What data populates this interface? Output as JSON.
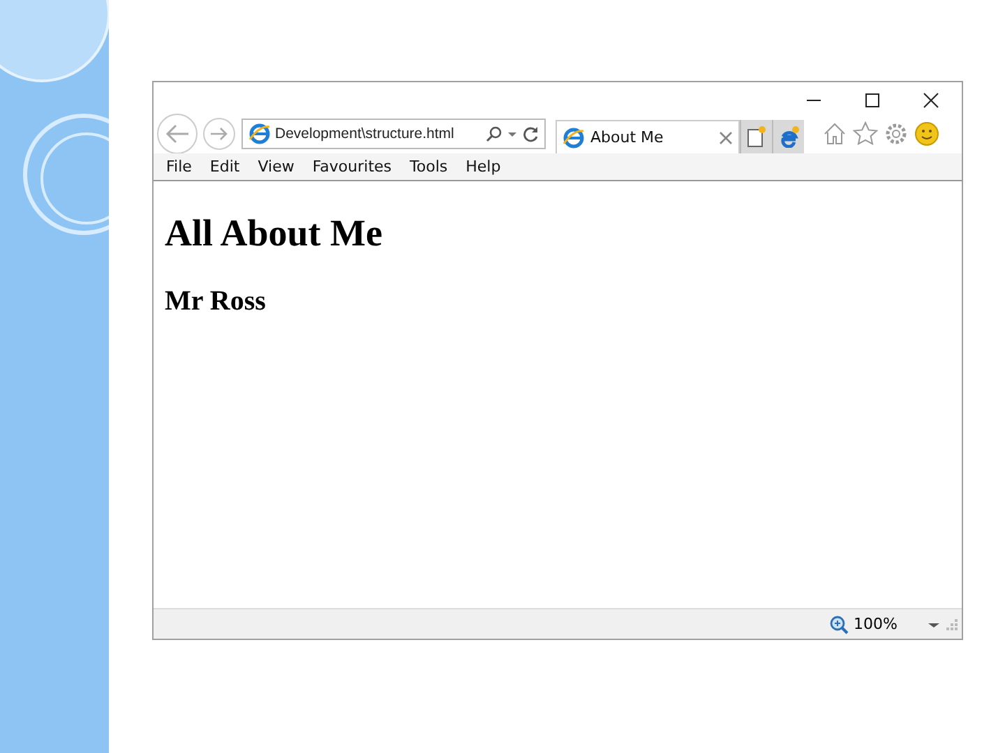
{
  "address_bar": {
    "value": "Development\\structure.html"
  },
  "tabs": [
    {
      "label": "About Me",
      "selected": true
    }
  ],
  "menu": [
    "File",
    "Edit",
    "View",
    "Favourites",
    "Tools",
    "Help"
  ],
  "page": {
    "heading": "All About Me",
    "subheading": "Mr Ross"
  },
  "status_bar": {
    "zoom": "100%"
  }
}
